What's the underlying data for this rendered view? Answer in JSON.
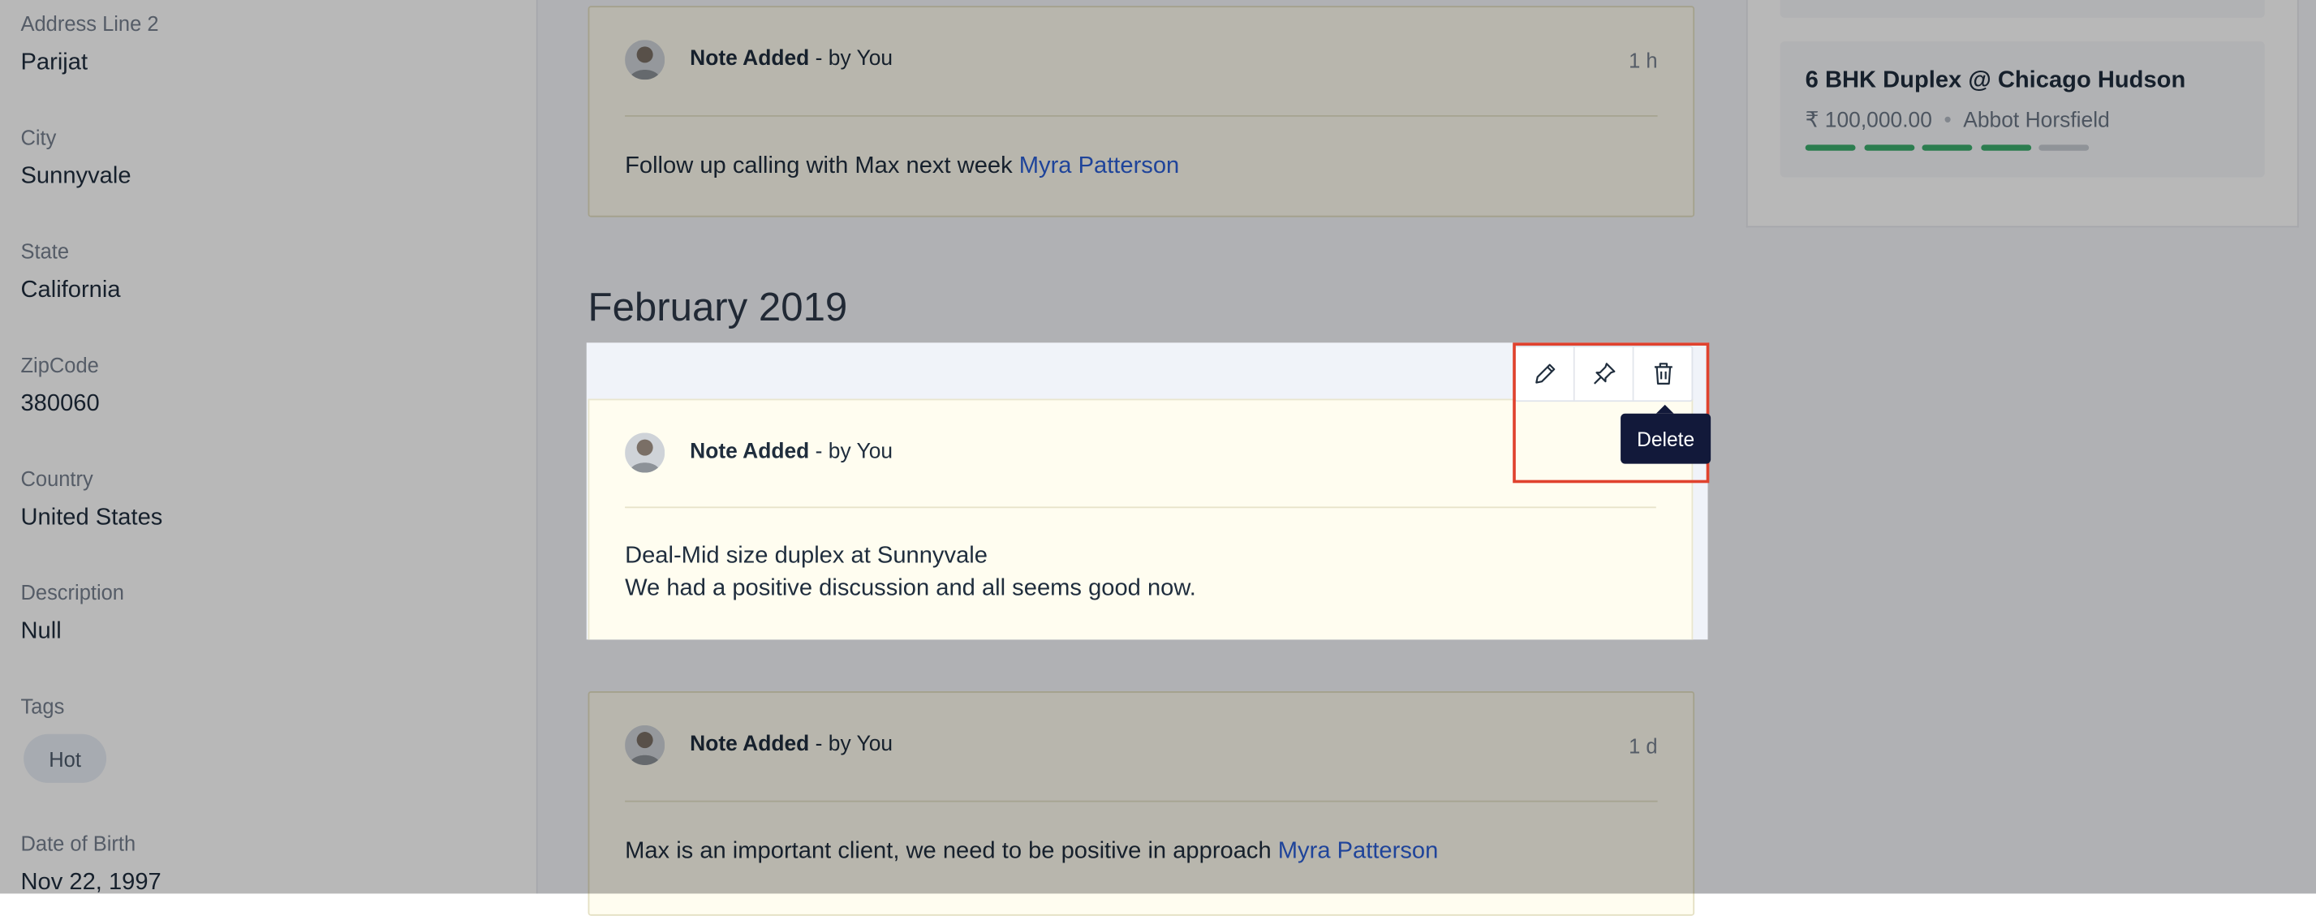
{
  "sidebar": {
    "fields": [
      {
        "label": "Address Line 2",
        "value": "Parijat"
      },
      {
        "label": "City",
        "value": "Sunnyvale"
      },
      {
        "label": "State",
        "value": "California"
      },
      {
        "label": "ZipCode",
        "value": "380060"
      },
      {
        "label": "Country",
        "value": "United States"
      },
      {
        "label": "Description",
        "value": "Null"
      },
      {
        "label": "Tags",
        "value": ""
      },
      {
        "label": "Date of Birth",
        "value": "Nov 22, 1997"
      }
    ],
    "tag": "Hot"
  },
  "timeline": {
    "card1": {
      "title": "Note Added",
      "by": " - by You",
      "time": "1 h",
      "text": "Follow up calling with Max next week ",
      "mention": "Myra Patterson"
    },
    "month": "February 2019",
    "card2": {
      "title": "Note Added",
      "by": " - by You",
      "line1": "Deal-Mid size duplex at Sunnyvale",
      "line2": "We had a positive discussion and all seems good now."
    },
    "card3": {
      "title": "Note Added",
      "by": " - by You",
      "time": "1 d",
      "text": "Max is an important client, we need to be positive in approach ",
      "mention": "Myra Patterson"
    },
    "tooltip": "Delete"
  },
  "deal": {
    "title": "6 BHK Duplex @ Chicago Hudson",
    "amount": "₹ 100,000.00",
    "separator": "•",
    "owner": "Abbot Horsfield",
    "stage_progress": {
      "completed": 4,
      "total": 5
    },
    "colors": {
      "complete": "#3cae6e",
      "incomplete": "#c7ccd3"
    }
  }
}
